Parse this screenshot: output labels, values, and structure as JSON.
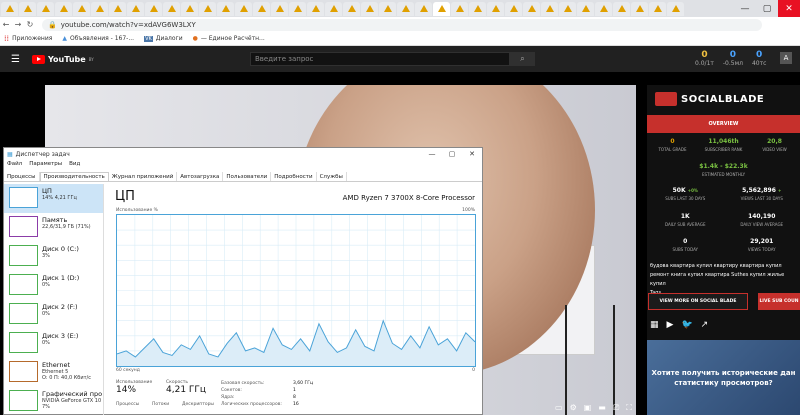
{
  "browser": {
    "url": "youtube.com/watch?v=xdAVG6W3LXY",
    "bookmarks": [
      "Приложения",
      "Объявления - 167-...",
      "Диалоги",
      "— Единое Расчётн..."
    ]
  },
  "youtube": {
    "logo": "YouTube",
    "logo_region": "BY",
    "search_placeholder": "Введите запрос",
    "stats": [
      {
        "value": "0",
        "label": "0.0/1т"
      },
      {
        "value": "0",
        "label": "-0.5мл"
      },
      {
        "value": "0",
        "label": "40тс"
      }
    ]
  },
  "socialblade": {
    "brand": "SOCIALBLADE",
    "overview": "OVERVIEW",
    "row1": [
      {
        "value": "0",
        "label": "TOTAL GRADE"
      },
      {
        "value": "11,046th",
        "label": "SUBSCRIBER RANK"
      },
      {
        "value": "20,8",
        "label": "VIDEO VIEW"
      }
    ],
    "earnings": {
      "value": "$1.4k - $22.3k",
      "label": "ESTIMATED MONTHLY"
    },
    "row2": [
      {
        "value": "50K",
        "delta": "+0%",
        "label": "SUBS LAST 30 DAYS"
      },
      {
        "value": "5,562,896",
        "delta": "+",
        "label": "VIEWS LAST 30 DAYS"
      }
    ],
    "row3": [
      {
        "value": "1K",
        "label": "DAILY SUB AVERAGE"
      },
      {
        "value": "140,190",
        "label": "DAILY VIEW AVERAGE"
      }
    ],
    "row4": [
      {
        "value": "0",
        "label": "SUBS TODAY"
      },
      {
        "value": "29,201",
        "label": "VIEWS TODAY"
      }
    ],
    "tags": "будова квартира купил квартиру квартира купил ремонт книга купил квартира Suthes купил жилье купил",
    "tags2": "Tags",
    "btn_more": "VIEW MORE ON SOCIAL BLADE",
    "btn_live": "LIVE SUB COUN",
    "ad_text": "Хотите получить исторические дан статистику просмотров?"
  },
  "taskmgr": {
    "title": "Диспетчер задач",
    "menu": [
      "Файл",
      "Параметры",
      "Вид"
    ],
    "tabs": [
      "Процессы",
      "Производительность",
      "Журнал приложений",
      "Автозагрузка",
      "Пользователи",
      "Подробности",
      "Службы"
    ],
    "resources": [
      {
        "name": "ЦП",
        "sub": "14% 4,21 ГГц",
        "color": "#4aa3d8"
      },
      {
        "name": "Память",
        "sub": "22,6/31,9 ГБ (71%)",
        "color": "#8b3ca8"
      },
      {
        "name": "Диск 0 (C:)",
        "sub": "3%",
        "color": "#4caf50"
      },
      {
        "name": "Диск 1 (D:)",
        "sub": "0%",
        "color": "#4caf50"
      },
      {
        "name": "Диск 2 (F:)",
        "sub": "0%",
        "color": "#4caf50"
      },
      {
        "name": "Диск 3 (E:)",
        "sub": "0%",
        "color": "#4caf50"
      },
      {
        "name": "Ethernet",
        "sub": "Ethernet 5\nО: 0 П: 40,0 Кбит/с",
        "color": "#b56a2c"
      },
      {
        "name": "Графический про",
        "sub": "NVIDIA GeForce GTX 10\n7%",
        "color": "#4caf50"
      }
    ],
    "heading": "ЦП",
    "processor": "AMD Ryzen 7 3700X 8-Core Processor",
    "graph_label_left": "Использование %",
    "graph_label_right": "100%",
    "graph_bottom_left": "60 секунд",
    "graph_bottom_right": "0",
    "usage_label": "Использование",
    "usage_value": "14%",
    "speed_label": "Скорость",
    "speed_value": "4,21 ГГц",
    "processes_label": "Процессы",
    "threads_label": "Потоки",
    "handles_label": "Дескрипторы",
    "specs": [
      {
        "k": "Базовая скорость:",
        "v": "3,60 ГГц"
      },
      {
        "k": "Сокетов:",
        "v": "1"
      },
      {
        "k": "Ядра:",
        "v": "8"
      },
      {
        "k": "Логических процессоров:",
        "v": "16"
      }
    ],
    "cpu_history": [
      8,
      10,
      6,
      12,
      18,
      9,
      7,
      14,
      11,
      20,
      8,
      6,
      15,
      22,
      10,
      12,
      9,
      25,
      14,
      11,
      18,
      10,
      28,
      16,
      9,
      12,
      24,
      13,
      10,
      30,
      15,
      11,
      20,
      12,
      26,
      14,
      18,
      10,
      22,
      16
    ]
  }
}
